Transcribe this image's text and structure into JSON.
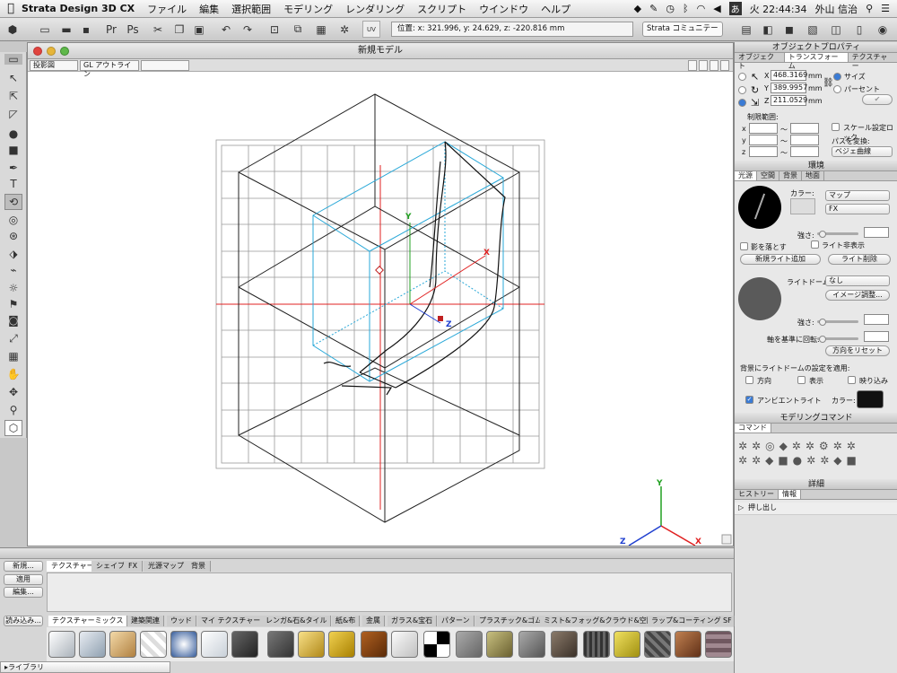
{
  "menubar": {
    "app": "Strata Design 3D CX",
    "items": [
      "ファイル",
      "編集",
      "選択範囲",
      "モデリング",
      "レンダリング",
      "スクリプト",
      "ウインドウ",
      "ヘルプ"
    ],
    "clock": "火 22:44:34",
    "user": "外山 信治",
    "input_mode": "あ"
  },
  "toolbar": {
    "position_readout": "位置: x: 321.996, y: 24.629, z: -220.816 mm",
    "community_label": "Strata コミュニテー"
  },
  "viewport": {
    "title": "新規モデル",
    "projection": "投影図",
    "render_mode": "GL アウトライン",
    "axis_x": "X",
    "axis_y": "Y",
    "axis_z": "Z"
  },
  "object_props": {
    "title": "オブジェクトプロパティ",
    "tabs": [
      "オブジェクト",
      "トランスフォーム",
      "テクスチャー"
    ],
    "x_label": "X",
    "y_label": "Y",
    "z_label": "Z",
    "x_value": "468.3169",
    "y_value": "389.9957",
    "z_value": "211.0529",
    "unit": "mm",
    "radio_size": "サイズ",
    "radio_percent": "パーセント",
    "limit_label": "制限範囲:",
    "lim_x": "x",
    "lim_y": "y",
    "lim_z": "z",
    "tilde": "〜",
    "scale_lock": "スケール設定ロック",
    "path_convert_label": "パスを変換:",
    "path_convert_value": "ベジェ曲線"
  },
  "environment": {
    "title": "環境",
    "tabs": [
      "光源",
      "空間",
      "背景",
      "地面"
    ],
    "color_label": "カラー:",
    "map_popup": "マップ",
    "fx_popup": "FX",
    "strength_label": "強さ:",
    "cast_shadow": "影を落とす",
    "hide_light": "ライト非表示",
    "add_light": "新規ライト追加",
    "delete_light": "ライト削除",
    "light_dome_label": "ライトドーム:",
    "light_dome_value": "なし",
    "image_adjust": "イメージ調整...",
    "strength2_label": "強さ:",
    "rotate_label": "軸を基準に回転:",
    "reset_direction": "方向をリセット",
    "apply_dome_label": "背景にライトドームの設定を適用:",
    "opt_direction": "方向",
    "opt_display": "表示",
    "opt_reflect": "映り込み",
    "ambient_label": "アンビエントライト",
    "ambient_color_label": "カラー:"
  },
  "modeling": {
    "title": "モデリングコマンド",
    "tab": "コマンド"
  },
  "details": {
    "title": "詳細",
    "tabs": [
      "ヒストリー",
      "情報"
    ],
    "history_item": "押し出し"
  },
  "bottom": {
    "tabs": [
      "テクスチャー",
      "シェイプ",
      "FX",
      "光源マップ",
      "背景"
    ],
    "new_btn": "新規...",
    "apply_btn": "適用",
    "edit_btn": "編集...",
    "load_btn": "読み込み...",
    "library_tabs": [
      "テクスチャーミックス",
      "建築関連",
      "ウッド",
      "マイ テクスチャー",
      "レンガ&石&タイル",
      "紙&布",
      "金属",
      "ガラス&宝石",
      "パターン",
      "プラスチック&ゴム",
      "ミスト&フォッグ&クラウド&空間",
      "ラップ&コーティング",
      "SF"
    ],
    "library_popup": "▸ライブラリ"
  },
  "colors": {
    "accent_blue": "#3a7bd5",
    "axis_red": "#e02020",
    "axis_green": "#20a020",
    "axis_blue": "#2040d0",
    "cyan_box": "#29a8d8"
  },
  "icons": {
    "menubar": [
      "apple-icon",
      "dropbox-icon",
      "pin-icon",
      "time-machine-icon",
      "bluetooth-icon",
      "wifi-icon",
      "volume-icon",
      "search-icon",
      "list-icon"
    ]
  }
}
